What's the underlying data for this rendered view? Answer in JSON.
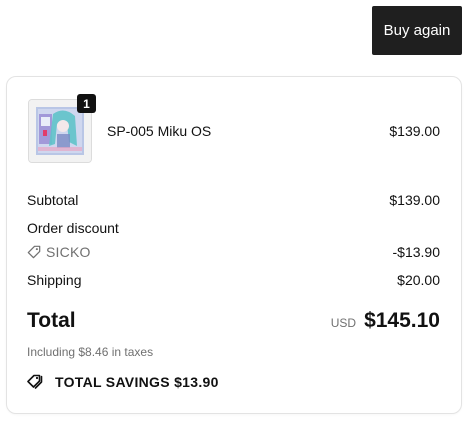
{
  "header": {
    "buy_again_label": "Buy again"
  },
  "order": {
    "item": {
      "quantity": "1",
      "name": "SP-005 Miku OS",
      "price": "$139.00"
    },
    "summary": {
      "subtotal_label": "Subtotal",
      "subtotal_value": "$139.00",
      "order_discount_label": "Order discount",
      "discount_code": "SICKO",
      "discount_value": "-$13.90",
      "shipping_label": "Shipping",
      "shipping_value": "$20.00",
      "total_label": "Total",
      "currency": "USD",
      "total_value": "$145.10",
      "taxes_note": "Including $8.46 in taxes",
      "savings_label": "TOTAL SAVINGS $13.90"
    }
  },
  "icons": {
    "discount_tag": "tag-icon",
    "savings_tags": "tags-icon"
  }
}
